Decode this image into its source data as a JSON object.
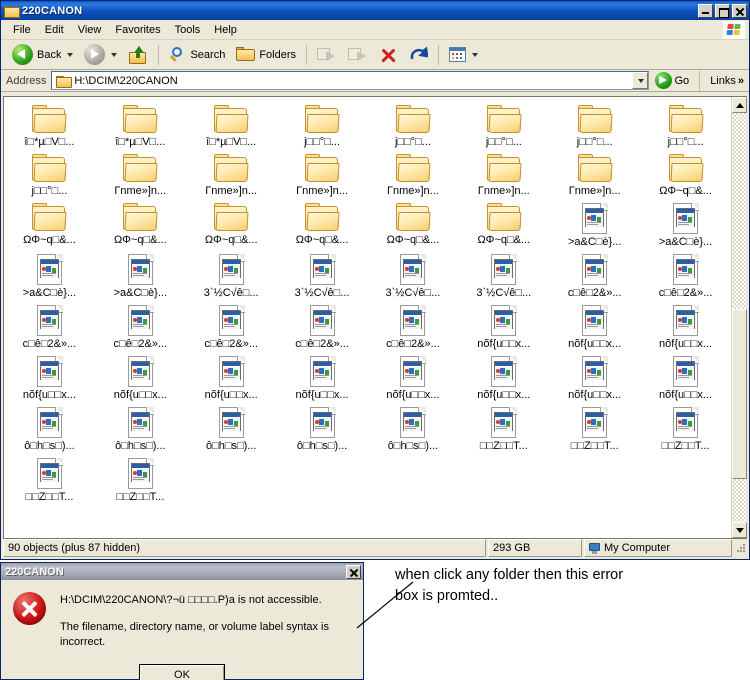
{
  "window": {
    "title": "220CANON",
    "title_icon": "folder-icon",
    "buttons": {
      "minimize": "_",
      "maximize": "□",
      "close": "✕"
    }
  },
  "menubar": {
    "items": [
      "File",
      "Edit",
      "View",
      "Favorites",
      "Tools",
      "Help"
    ],
    "brand_icon": "windows-flag-icon"
  },
  "toolbar": {
    "back_label": "Back",
    "back_icon": "back-arrow-icon",
    "forward_icon": "forward-arrow-icon",
    "up_icon": "up-one-level-icon",
    "search_label": "Search",
    "search_icon": "search-icon",
    "folders_label": "Folders",
    "folders_icon": "folders-icon",
    "move_to_icon": "move-to-folder-icon",
    "copy_to_icon": "copy-to-folder-icon",
    "delete_icon": "delete-icon",
    "undo_icon": "undo-icon",
    "views_icon": "views-icon"
  },
  "address": {
    "label": "Address",
    "value": "H:\\DCIM\\220CANON",
    "icon": "folder-icon",
    "dropdown_icon": "chevron-down-icon",
    "go_label": "Go",
    "go_icon": "go-arrow-icon",
    "links_label": "Links",
    "links_chevron": "»"
  },
  "files": {
    "rows": [
      {
        "type": "folder",
        "labels": [
          "î□*µ□V□...",
          "î□*µ□V□...",
          "î□*µ□V□...",
          "j□□°□...",
          "j□□°□...",
          "j□□°□...",
          "j□□°□...",
          "j□□°□..."
        ]
      },
      {
        "type": "folder",
        "labels": [
          "j□□°□...",
          "Гnme»]n...",
          "Гnme»]n...",
          "Гnme»]n...",
          "Гnme»]n...",
          "Гnme»]n...",
          "Гnme»]n...",
          "ΩΦ~q□&..."
        ]
      },
      {
        "type": "mixed",
        "labels": [
          "ΩΦ~q□&...",
          "ΩΦ~q□&...",
          "ΩΦ~q□&...",
          "ΩΦ~q□&...",
          "ΩΦ~q□&...",
          "ΩΦ~q□&...",
          ">a&C□è}...",
          ">a&C□è}..."
        ],
        "types": [
          "folder",
          "folder",
          "folder",
          "folder",
          "folder",
          "folder",
          "file",
          "file"
        ]
      },
      {
        "type": "file",
        "labels": [
          ">a&C□è}...",
          ">a&C□è}...",
          "3`½C√ê□...",
          "3`½C√ê□...",
          "3`½C√ê□...",
          "3`½C√ê□...",
          "c□ê□2&»...",
          "c□ê□2&»..."
        ]
      },
      {
        "type": "file",
        "labels": [
          "c□ê□2&»...",
          "c□ê□2&»...",
          "c□ê□2&»...",
          "c□ê□2&»...",
          "c□ê□2&»...",
          "nõf{u□□x...",
          "nõf{u□□x...",
          "nõf{u□□x..."
        ]
      },
      {
        "type": "file",
        "labels": [
          "nõf{u□□x...",
          "nõf{u□□x...",
          "nõf{u□□x...",
          "nõf{u□□x...",
          "nõf{u□□x...",
          "nõf{u□□x...",
          "nõf{u□□x...",
          "nõf{u□□x..."
        ]
      },
      {
        "type": "file",
        "labels": [
          "ô□h□s□)...",
          "ô□h□s□)...",
          "ô□h□s□)...",
          "ô□h□s□)...",
          "ô□h□s□)...",
          "□□Z□□T...",
          "□□Z□□T...",
          "□□Z□□T..."
        ]
      }
    ],
    "extra_row": {
      "type": "file",
      "labels": [
        "□□Z□□T...",
        "□□Z□□T..."
      ]
    },
    "scrollbar": {
      "up_icon": "scroll-up-icon",
      "down_icon": "scroll-down-icon"
    }
  },
  "statusbar": {
    "objects": "90 objects (plus 87 hidden)",
    "size": "293 GB",
    "location": "My Computer",
    "location_icon": "my-computer-icon"
  },
  "dialog": {
    "title": "220CANON",
    "close_label": "✕",
    "error_icon": "error-icon",
    "message_line1": "H:\\DCIM\\220CANON\\?¬ü □□□□.P)a is not accessible.",
    "message_line2": "The filename, directory name, or volume label syntax is incorrect.",
    "ok_label": "OK"
  },
  "annotation": {
    "line1": "when click any folder then this error",
    "line2": "box is promted.."
  }
}
